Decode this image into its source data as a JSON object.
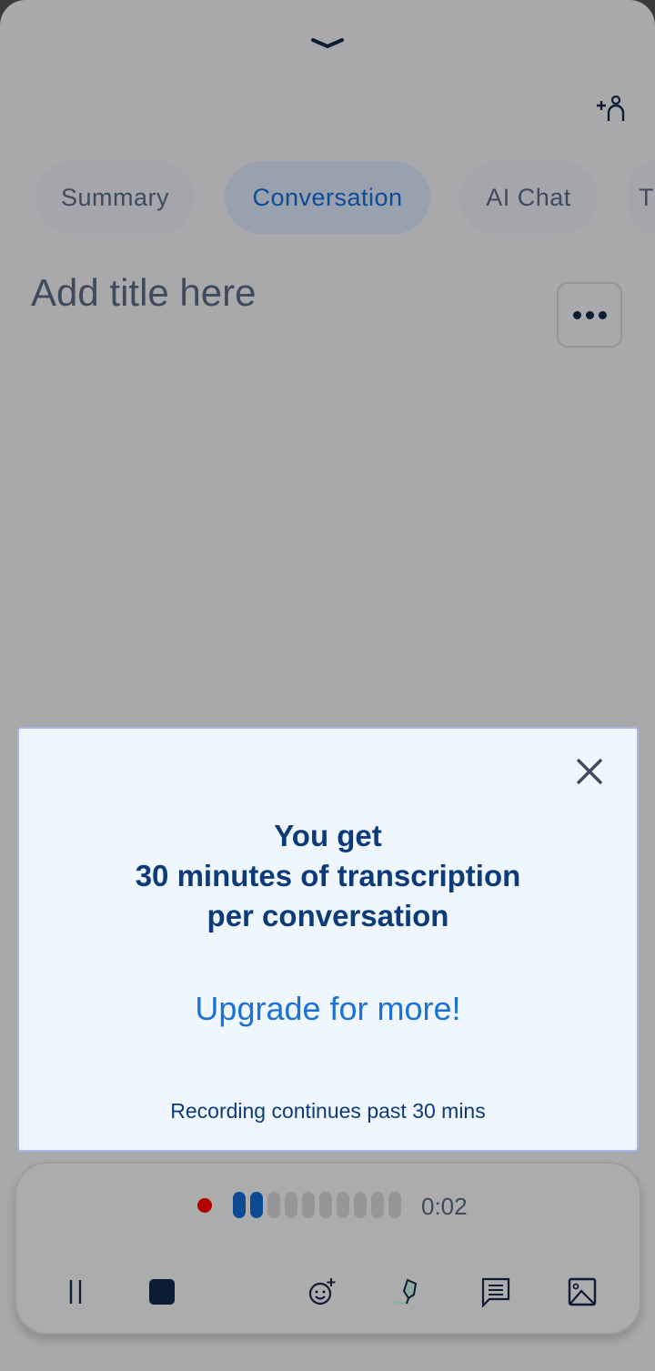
{
  "header": {
    "collapse_icon": "chevron-down-icon",
    "add_participant_icon": "person-add-icon"
  },
  "tabs": [
    {
      "label": "Summary",
      "active": false
    },
    {
      "label": "Conversation",
      "active": true
    },
    {
      "label": "AI Chat",
      "active": false
    },
    {
      "label": "T",
      "active": false
    }
  ],
  "title_placeholder": "Add title here",
  "dialog": {
    "line1": "You get",
    "line2": "30 minutes of transcription",
    "line3": "per conversation",
    "upgrade": "Upgrade for more!",
    "footnote": "Recording continues past 30 mins"
  },
  "recorder": {
    "elapsed": "0:02",
    "level_segments_total": 10,
    "level_segments_active": 2,
    "record_color": "#b50000",
    "accent": "#0c4a94"
  },
  "toolbar": [
    "pause-icon",
    "stop-icon",
    "add-reaction-icon",
    "highlighter-icon",
    "comment-icon",
    "image-icon"
  ]
}
